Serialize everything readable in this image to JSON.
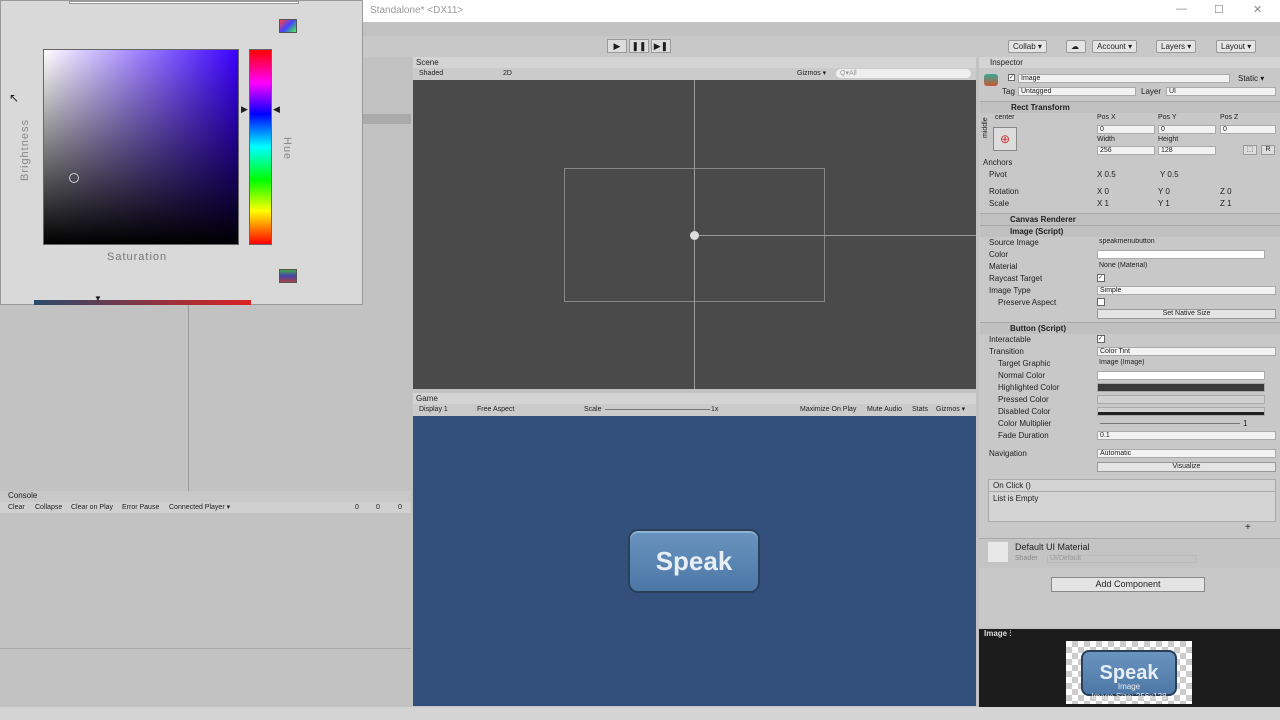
{
  "window": {
    "title": "Standalone* <DX11>"
  },
  "toolbar": {
    "play": "▶",
    "pause": "❚❚",
    "step": "▶❚",
    "collab": "Collab ▾",
    "account": "Account ▾",
    "layers": "Layers ▾",
    "layout": "Layout ▾"
  },
  "color_picker": {
    "brightness_label": "Brightness",
    "hue_label": "Hue",
    "saturation_label": "Saturation"
  },
  "scene": {
    "tab": "Scene",
    "shading": "Shaded",
    "mode_2d": "2D",
    "gizmos": "Gizmos ▾",
    "search": "Q▾All"
  },
  "game": {
    "tab": "Game",
    "display": "Display 1",
    "aspect": "Free Aspect",
    "scale_label": "Scale",
    "scale_value": "1x",
    "maximize": "Maximize On Play",
    "mute": "Mute Audio",
    "stats": "Stats",
    "gizmos": "Gizmos ▾",
    "button_text": "Speak"
  },
  "console": {
    "tab": "Console",
    "buttons": [
      "Clear",
      "Collapse",
      "Clear on Play",
      "Error Pause",
      "Connected Player ▾"
    ],
    "counts": [
      "0",
      "0",
      "0"
    ]
  },
  "inspector": {
    "tab": "Inspector",
    "object_name": "Image",
    "static": "Static ▾",
    "tag_label": "Tag",
    "tag_value": "Untagged",
    "layer_label": "Layer",
    "layer_value": "UI",
    "rect_transform": "Rect Transform",
    "anchor_h": "center",
    "anchor_v": "middle",
    "pos_x_label": "Pos X",
    "pos_y_label": "Pos Y",
    "pos_z_label": "Pos Z",
    "pos_x": "0",
    "pos_y": "0",
    "pos_z": "0",
    "width_label": "Width",
    "height_label": "Height",
    "width": "256",
    "height": "128",
    "anchors": "Anchors",
    "pivot_label": "Pivot",
    "pivot_x": "X 0.5",
    "pivot_y": "Y 0.5",
    "rotation_label": "Rotation",
    "rot_x": "X 0",
    "rot_y": "Y 0",
    "rot_z": "Z 0",
    "scale_label": "Scale",
    "scale_x": "X 1",
    "scale_y": "Y 1",
    "scale_z": "Z 1",
    "canvas_renderer": "Canvas Renderer",
    "image_script": "Image (Script)",
    "source_image_label": "Source Image",
    "source_image": "speakmenubutton",
    "color_label": "Color",
    "material_label": "Material",
    "material": "None (Material)",
    "raycast_label": "Raycast Target",
    "image_type_label": "Image Type",
    "image_type": "Simple",
    "preserve_label": "Preserve Aspect",
    "native_size": "Set Native Size",
    "button_script": "Button (Script)",
    "interactable_label": "Interactable",
    "transition_label": "Transition",
    "transition": "Color Tint",
    "target_graphic_label": "Target Graphic",
    "target_graphic": "Image (Image)",
    "normal_label": "Normal Color",
    "highlighted_label": "Highlighted Color",
    "pressed_label": "Pressed Color",
    "disabled_label": "Disabled Color",
    "multiplier_label": "Color Multiplier",
    "multiplier": "1",
    "fade_label": "Fade Duration",
    "fade": "0.1",
    "navigation_label": "Navigation",
    "navigation": "Automatic",
    "visualize": "Visualize",
    "onclick": "On Click ()",
    "list_empty": "List is Empty",
    "material_name": "Default UI Material",
    "shader_label": "Shader",
    "shader": "UI/Default",
    "add_component": "Add Component",
    "preview_tab": "Image ⫶",
    "preview_button": "Speak",
    "preview_caption1": "Image",
    "preview_caption2": "Image Size: 256x128"
  }
}
